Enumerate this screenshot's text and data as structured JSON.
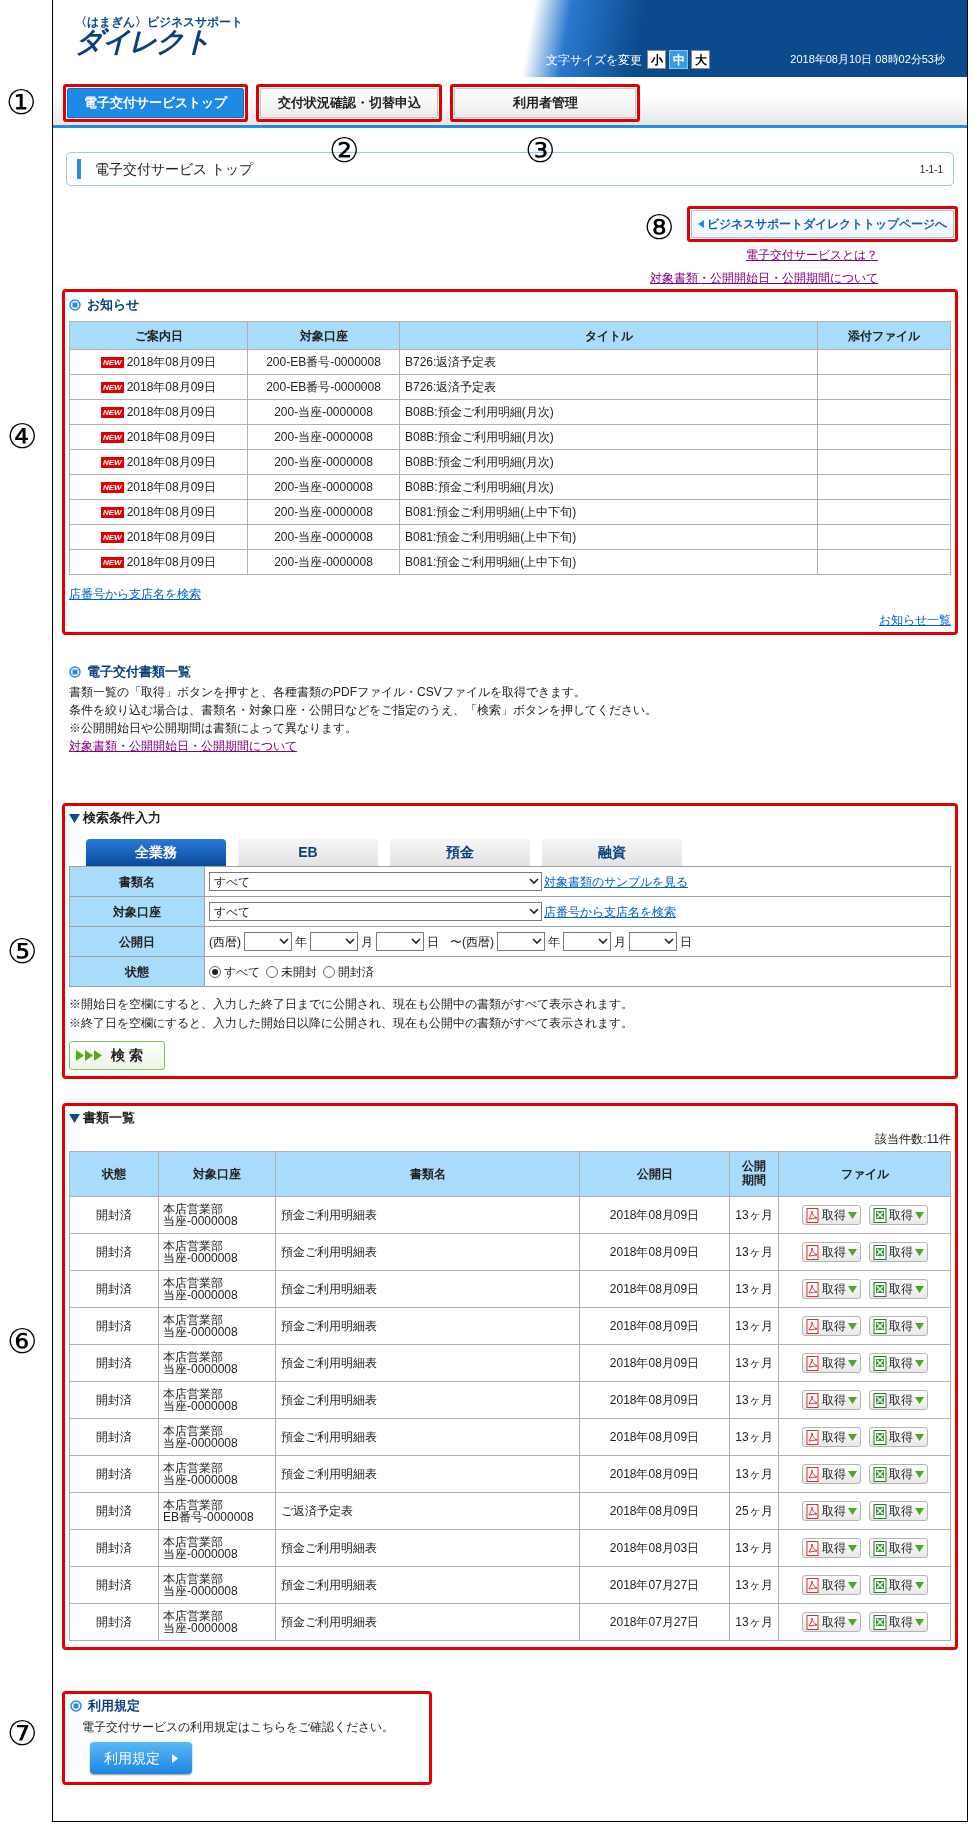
{
  "header": {
    "logo_small": "〈はまぎん〉ビジネスサポート",
    "logo_main": "ダイレクト",
    "font_size_label": "文字サイズを変更",
    "font_sizes": [
      {
        "label": "小",
        "selected": false
      },
      {
        "label": "中",
        "selected": true
      },
      {
        "label": "大",
        "selected": false
      }
    ],
    "datetime": "2018年08月10日 08時02分53秒"
  },
  "nav_tabs": [
    {
      "label": "電子交付サービストップ",
      "selected": true,
      "callout": "①"
    },
    {
      "label": "交付状況確認・切替申込",
      "selected": false,
      "callout": "②"
    },
    {
      "label": "利用者管理",
      "selected": false,
      "callout": "③"
    }
  ],
  "breadcrumb": {
    "title": "電子交付サービス トップ",
    "page_id": "1-1-1"
  },
  "top_link": {
    "label": "ビジネスサポートダイレクトトップページへ",
    "callout": "⑧"
  },
  "links": [
    "電子交付サービスとは？",
    "対象書類・公開開始日・公開期間について"
  ],
  "notices": {
    "callout": "④",
    "title": "お知らせ",
    "columns": [
      "ご案内日",
      "対象口座",
      "タイトル",
      "添付ファイル"
    ],
    "rows": [
      {
        "badge": "NEW",
        "date": "2018年08月09日",
        "account": "200-EB番号-0000008",
        "title": "B726:返済予定表"
      },
      {
        "badge": "NEW",
        "date": "2018年08月09日",
        "account": "200-EB番号-0000008",
        "title": "B726:返済予定表"
      },
      {
        "badge": "NEW",
        "date": "2018年08月09日",
        "account": "200-当座-0000008",
        "title": "B08B:預金ご利用明細(月次)"
      },
      {
        "badge": "NEW",
        "date": "2018年08月09日",
        "account": "200-当座-0000008",
        "title": "B08B:預金ご利用明細(月次)"
      },
      {
        "badge": "NEW",
        "date": "2018年08月09日",
        "account": "200-当座-0000008",
        "title": "B08B:預金ご利用明細(月次)"
      },
      {
        "badge": "NEW",
        "date": "2018年08月09日",
        "account": "200-当座-0000008",
        "title": "B08B:預金ご利用明細(月次)"
      },
      {
        "badge": "NEW",
        "date": "2018年08月09日",
        "account": "200-当座-0000008",
        "title": "B081:預金ご利用明細(上中下旬)"
      },
      {
        "badge": "NEW",
        "date": "2018年08月09日",
        "account": "200-当座-0000008",
        "title": "B081:預金ご利用明細(上中下旬)"
      },
      {
        "badge": "NEW",
        "date": "2018年08月09日",
        "account": "200-当座-0000008",
        "title": "B081:預金ご利用明細(上中下旬)"
      }
    ],
    "branch_link": "店番号から支店名を検索",
    "all_link": "お知らせ一覧"
  },
  "documents_intro": {
    "title": "電子交付書類一覧",
    "lines": [
      "書類一覧の「取得」ボタンを押すと、各種書類のPDFファイル・CSVファイルを取得できます。",
      "条件を絞り込む場合は、書類名・対象口座・公開日などをご指定のうえ、「検索」ボタンを押してください。",
      "※公開開始日や公開期間は書類によって異なります。"
    ],
    "link": "対象書類・公開開始日・公開期間について"
  },
  "search": {
    "callout": "⑤",
    "title": "検索条件入力",
    "tabs": [
      {
        "label": "全業務",
        "selected": true
      },
      {
        "label": "EB",
        "selected": false
      },
      {
        "label": "預金",
        "selected": false
      },
      {
        "label": "融資",
        "selected": false
      }
    ],
    "rows": [
      {
        "kind": "select",
        "label": "書類名",
        "value": "すべて",
        "link": "対象書類のサンプルを見る"
      },
      {
        "kind": "select",
        "label": "対象口座",
        "value": "すべて",
        "link": "店番号から支店名を検索"
      },
      {
        "kind": "dates",
        "label": "公開日",
        "parts": [
          {
            "kind": "text",
            "text": "(西暦)"
          },
          {
            "kind": "select"
          },
          {
            "kind": "text",
            "text": "年"
          },
          {
            "kind": "select"
          },
          {
            "kind": "text",
            "text": "月"
          },
          {
            "kind": "select"
          },
          {
            "kind": "text",
            "text": "日"
          },
          {
            "kind": "text",
            "text": "〜(西暦)"
          },
          {
            "kind": "select"
          },
          {
            "kind": "text",
            "text": "年"
          },
          {
            "kind": "select"
          },
          {
            "kind": "text",
            "text": "月"
          },
          {
            "kind": "select"
          },
          {
            "kind": "text",
            "text": "日"
          }
        ]
      },
      {
        "kind": "radios",
        "label": "状態",
        "options": [
          {
            "label": "すべて",
            "selected": true
          },
          {
            "label": "未開封",
            "selected": false
          },
          {
            "label": "開封済",
            "selected": false
          }
        ]
      }
    ],
    "notes": [
      "※開始日を空欄にすると、入力した終了日までに公開され、現在も公開中の書類がすべて表示されます。",
      "※終了日を空欄にすると、入力した開始日以降に公開され、現在も公開中の書類がすべて表示されます。"
    ],
    "button": "検 索"
  },
  "results": {
    "callout": "⑥",
    "title": "書類一覧",
    "count": "該当件数:11件",
    "columns": [
      "状態",
      "対象口座",
      "書類名",
      "公開日",
      "公開期間",
      "ファイル"
    ],
    "rows": [
      {
        "status": "開封済",
        "branch": "本店営業部",
        "account": "当座-0000008",
        "name": "預金ご利用明細表",
        "date": "2018年08月09日",
        "period": "13ヶ月",
        "files": [
          {
            "kind": "pdf",
            "label": "取得"
          },
          {
            "kind": "csv",
            "label": "取得"
          }
        ]
      },
      {
        "status": "開封済",
        "branch": "本店営業部",
        "account": "当座-0000008",
        "name": "預金ご利用明細表",
        "date": "2018年08月09日",
        "period": "13ヶ月",
        "files": [
          {
            "kind": "pdf",
            "label": "取得"
          },
          {
            "kind": "csv",
            "label": "取得"
          }
        ]
      },
      {
        "status": "開封済",
        "branch": "本店営業部",
        "account": "当座-0000008",
        "name": "預金ご利用明細表",
        "date": "2018年08月09日",
        "period": "13ヶ月",
        "files": [
          {
            "kind": "pdf",
            "label": "取得"
          },
          {
            "kind": "csv",
            "label": "取得"
          }
        ]
      },
      {
        "status": "開封済",
        "branch": "本店営業部",
        "account": "当座-0000008",
        "name": "預金ご利用明細表",
        "date": "2018年08月09日",
        "period": "13ヶ月",
        "files": [
          {
            "kind": "pdf",
            "label": "取得"
          },
          {
            "kind": "csv",
            "label": "取得"
          }
        ]
      },
      {
        "status": "開封済",
        "branch": "本店営業部",
        "account": "当座-0000008",
        "name": "預金ご利用明細表",
        "date": "2018年08月09日",
        "period": "13ヶ月",
        "files": [
          {
            "kind": "pdf",
            "label": "取得"
          },
          {
            "kind": "csv",
            "label": "取得"
          }
        ]
      },
      {
        "status": "開封済",
        "branch": "本店営業部",
        "account": "当座-0000008",
        "name": "預金ご利用明細表",
        "date": "2018年08月09日",
        "period": "13ヶ月",
        "files": [
          {
            "kind": "pdf",
            "label": "取得"
          },
          {
            "kind": "csv",
            "label": "取得"
          }
        ]
      },
      {
        "status": "開封済",
        "branch": "本店営業部",
        "account": "当座-0000008",
        "name": "預金ご利用明細表",
        "date": "2018年08月09日",
        "period": "13ヶ月",
        "files": [
          {
            "kind": "pdf",
            "label": "取得"
          },
          {
            "kind": "csv",
            "label": "取得"
          }
        ]
      },
      {
        "status": "開封済",
        "branch": "本店営業部",
        "account": "当座-0000008",
        "name": "預金ご利用明細表",
        "date": "2018年08月09日",
        "period": "13ヶ月",
        "files": [
          {
            "kind": "pdf",
            "label": "取得"
          },
          {
            "kind": "csv",
            "label": "取得"
          }
        ]
      },
      {
        "status": "開封済",
        "branch": "本店営業部",
        "account": "EB番号-0000008",
        "name": "ご返済予定表",
        "date": "2018年08月09日",
        "period": "25ヶ月",
        "files": [
          {
            "kind": "pdf",
            "label": "取得"
          },
          {
            "kind": "csv",
            "label": "取得"
          }
        ]
      },
      {
        "status": "開封済",
        "branch": "本店営業部",
        "account": "当座-0000008",
        "name": "預金ご利用明細表",
        "date": "2018年08月03日",
        "period": "13ヶ月",
        "files": [
          {
            "kind": "pdf",
            "label": "取得"
          },
          {
            "kind": "csv",
            "label": "取得"
          }
        ]
      },
      {
        "status": "開封済",
        "branch": "本店営業部",
        "account": "当座-0000008",
        "name": "預金ご利用明細表",
        "date": "2018年07月27日",
        "period": "13ヶ月",
        "files": [
          {
            "kind": "pdf",
            "label": "取得"
          },
          {
            "kind": "csv",
            "label": "取得"
          }
        ]
      },
      {
        "status": "開封済",
        "branch": "本店営業部",
        "account": "当座-0000008",
        "name": "預金ご利用明細表",
        "date": "2018年07月27日",
        "period": "13ヶ月",
        "files": [
          {
            "kind": "pdf",
            "label": "取得"
          },
          {
            "kind": "csv",
            "label": "取得"
          }
        ]
      }
    ]
  },
  "terms": {
    "callout": "⑦",
    "title": "利用規定",
    "text": "電子交付サービスの利用規定はこちらをご確認ください。",
    "button": "利用規定"
  }
}
